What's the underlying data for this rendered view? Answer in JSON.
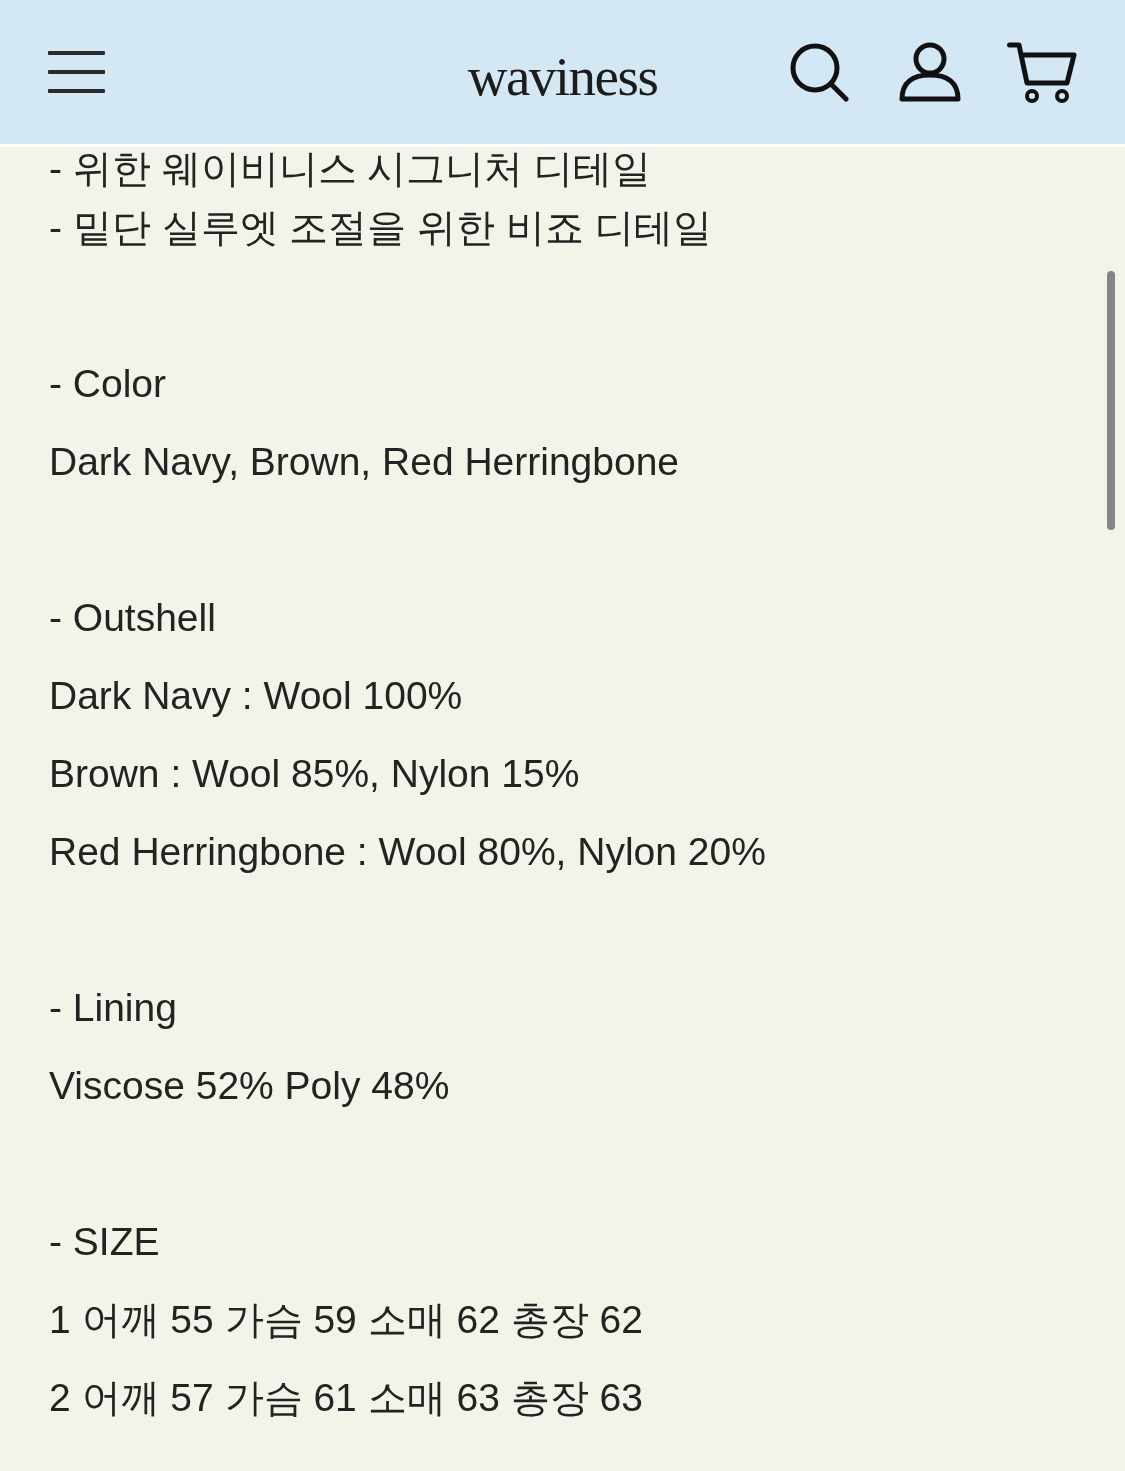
{
  "header": {
    "logo": "waviness"
  },
  "sections": [
    {
      "lines": [
        "- 위한 웨이비니스 시그니처 디테일",
        "- 밑단 실루엣 조절을 위한 비죠 디테일"
      ]
    },
    {
      "lines": [
        "- Color",
        "Dark Navy, Brown, Red Herringbone"
      ]
    },
    {
      "lines": [
        "- Outshell",
        "Dark Navy : Wool 100%",
        "Brown : Wool 85%, Nylon 15%",
        "Red Herringbone : Wool 80%, Nylon 20%"
      ]
    },
    {
      "lines": [
        "- Lining",
        "Viscose 52% Poly 48%"
      ]
    },
    {
      "lines": [
        "- SIZE",
        "1 어깨 55 가슴 59 소매 62 총장 62",
        "2 어깨 57 가슴 61 소매 63 총장 63"
      ]
    }
  ]
}
